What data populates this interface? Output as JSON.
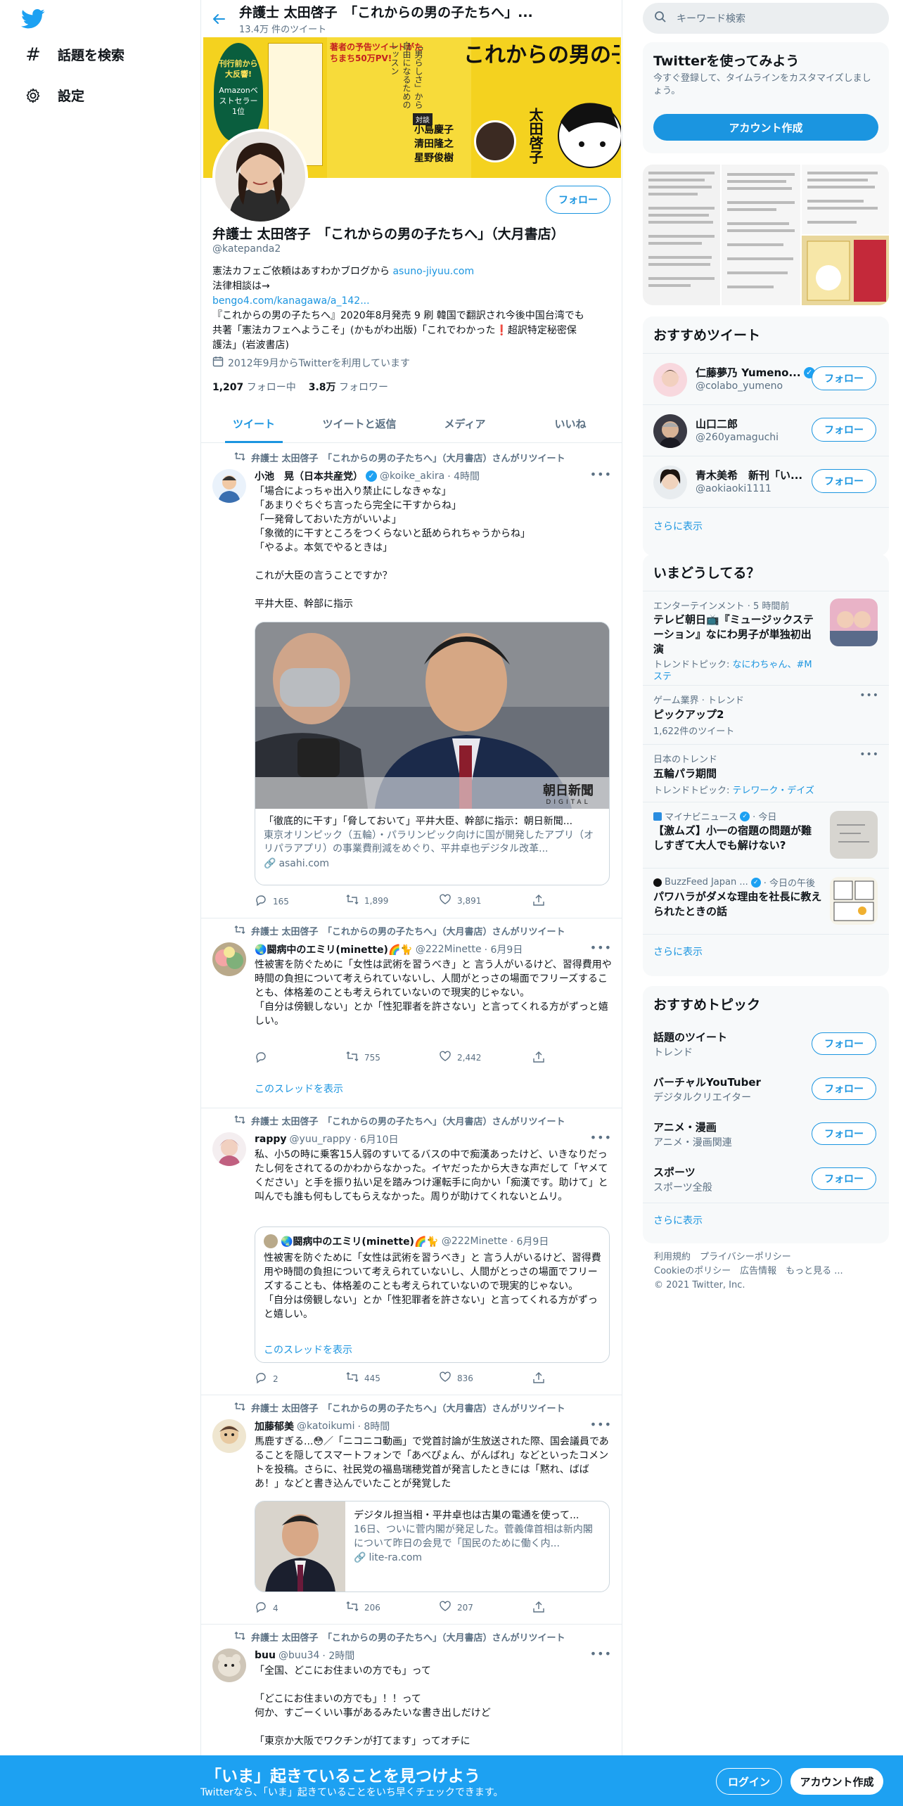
{
  "nav": {
    "explore": "話題を検索",
    "settings": "設定"
  },
  "header": {
    "title": "弁護士 太田啓子　「これからの男の子たちへ」...",
    "subtitle": "13.4万 件のツイート"
  },
  "banner": {
    "headline": "これからの男の子たちへ",
    "badge": "刊行前から大反響!",
    "badge2": "Amazonベストセラー1位",
    "promo": "著者の予告ツイートがたちまち50万PV!",
    "guests_label": "対談",
    "guests": [
      "小島慶子",
      "清田隆之",
      "星野俊樹"
    ],
    "author": "太田啓子"
  },
  "profile": {
    "name": "弁護士 太田啓子　「これからの男の子たちへ」（大月書店）",
    "handle": "@katepanda2",
    "follow_label": "フォロー",
    "bio_line1_pre": "憲法カフェご依頼はあすわかブログから ",
    "bio_line1_link": "asuno-jiyuu.com",
    "bio_line2": "法律相談は→",
    "bio_line3_link": "bengo4.com/kanagawa/a_142...",
    "bio_line4": "『これからの男の子たちへ』2020年8月発売  9 刷 韓国で翻訳され今後中国台湾でも",
    "bio_line5": "共著「憲法カフェへようこそ」(かもがわ出版)「これでわかった❗超訳特定秘密保",
    "bio_line6": "護法」(岩波書店)",
    "joined": "2012年9月からTwitterを利用しています",
    "following_count": "1,207",
    "following_label": "フォロー中",
    "followers_count": "3.8万",
    "followers_label": "フォロワー"
  },
  "tabs": [
    "ツイート",
    "ツイートと返信",
    "メディア",
    "いいね"
  ],
  "retweet_label": "弁護士 太田啓子　「これからの男の子たちへ」（大月書店）さんがリツイート",
  "tweets": [
    {
      "name": "小池　晃（日本共産党）",
      "handle": "@koike_akira",
      "time": "· 4時間",
      "text": "「場合によっちゃ出入り禁止にしなきゃな」\n「あまりぐちぐち言ったら完全に干すからね」\n「一発脅しておいた方がいいよ」\n「象徴的に干すところをつくらないと舐められちゃうからね」\n「やるよ。本気でやるときは」\n\nこれが大臣の言うことですか？\n\n平井大臣、幹部に指示",
      "card_title": "「徹底的に干す」「脅しておいて」平井大臣、幹部に指示：朝日新聞...",
      "card_desc": "東京オリンピック（五輪）・パラリンピック向けに国が開発したアプリ（オリパラアプリ）の事業費削減をめぐり、平井卓也デジタル改革...",
      "card_domain": "asahi.com",
      "card_logo": "朝日新聞",
      "card_logo_sub": "DIGITAL",
      "replies": "165",
      "retweets": "1,899",
      "likes": "3,891"
    },
    {
      "name": "🌏闘病中のエミリ(minette)🌈🐈",
      "handle": "@222Minette",
      "time": "· 6月9日",
      "text": "性被害を防ぐために「女性は武術を習うべき」と 言う人がいるけど、習得費用や時間の負担について考えられていないし、人間がとっさの場面でフリーズすることも、体格差のことも考えられていないので現実的じゃない。\n「自分は傍観しない」とか「性犯罪者を許さない」と言ってくれる方がずっと嬉しい。",
      "replies": "",
      "retweets": "755",
      "likes": "2,442",
      "show_thread": "このスレッドを表示"
    },
    {
      "name": "rappy",
      "handle": "@yuu_rappy",
      "time": "· 6月10日",
      "text": "私、小5の時に乗客15人弱のすいてるバスの中で痴漢あったけど、いきなりだったし何をされてるのかわからなかった。イヤだったから大きな声だして「ヤメてください」と手を振り払い足を踏みつけ運転手に向かい「痴漢です。助けて」と叫んでも誰も何もしてもらえなかった。周りが助けてくれないとムリ。",
      "quote_name": "🌏闘病中のエミリ(minette)🌈🐈",
      "quote_handle": "@222Minette",
      "quote_time": "· 6月9日",
      "quote_text": "性被害を防ぐために「女性は武術を習うべき」と 言う人がいるけど、習得費用や時間の負担について考えられていないし、人間がとっさの場面でフリーズすることも、体格差のことも考えられていないので現実的じゃない。\n「自分は傍観しない」とか「性犯罪者を許さない」と言ってくれる方がずっと嬉しい。",
      "quote_show_thread": "このスレッドを表示",
      "replies": "2",
      "retweets": "445",
      "likes": "836"
    },
    {
      "name": "加藤郁美",
      "handle": "@katoikumi",
      "time": "· 8時間",
      "text": "馬鹿すぎる...😳／「ニコニコ動画」で党首討論が生放送された際、国会議員であることを隠してスマートフォンで「あべぴょん、がんばれ」などといったコメントを投稿。さらに、社民党の福島瑞穂党首が発言したときには「黙れ、ばばあ！」などと書き込んでいたことが発覚した",
      "card_title": "デジタル担当相・平井卓也は古巣の電通を使って...",
      "card_desc": "16日、ついに菅内閣が発足した。菅義偉首相は新内閣について昨日の会見で「国民のために働く内...",
      "card_domain": "lite-ra.com",
      "replies": "4",
      "retweets": "206",
      "likes": "207"
    },
    {
      "name": "buu",
      "handle": "@buu34",
      "time": "· 2時間",
      "text": "「全国、どこにお住まいの方でも」って\n\n「どこにお住まいの方でも」！！って\n何か、すごーくいい事があるみたいな書き出しだけど\n\n「東京か大阪でワクチンが打てます」ってオチに"
    }
  ],
  "right": {
    "search_placeholder": "キーワード検索",
    "join_title": "Twitterを使ってみよう",
    "join_desc": "今すぐ登録して、タイムラインをカスタマイズしましょう。",
    "join_button": "アカウント作成",
    "rec_title": "おすすめツイート",
    "rec_users": [
      {
        "name": "仁藤夢乃 Yumeno...",
        "handle": "@colabo_yumeno",
        "verified": true
      },
      {
        "name": "山口二郎",
        "handle": "@260yamaguchi",
        "verified": false
      },
      {
        "name": "青木美希　新刊「い...",
        "handle": "@aokiaoki1111",
        "verified": false
      }
    ],
    "follow_label": "フォロー",
    "show_more": "さらに表示",
    "trends_title": "いまどうしてる？",
    "trends": [
      {
        "meta": "エンターテインメント · 5 時間前",
        "title": "テレビ朝日📺『ミュージックステーション』なにわ男子が単独初出演",
        "sub_pre": "トレンドトピック: ",
        "sub_links": "なにわちゃん、#Mステ"
      },
      {
        "meta": "ゲーム業界 · トレンド",
        "title": "ピックアップ2",
        "sub_pre": "1,622件のツイート",
        "sub_links": ""
      },
      {
        "meta": "日本のトレンド",
        "title": "五輪パラ期間",
        "sub_pre": "トレンドトピック: ",
        "sub_links": "テレワーク・デイズ"
      },
      {
        "meta_source": "マイナビニュース",
        "meta_time": "· 今日",
        "title": "【激ムズ】小一の宿題の問題が難しすぎて大人でも解けない?"
      },
      {
        "meta_source": "BuzzFeed Japan ...",
        "meta_time": "· 今日の午後",
        "title": "パワハラがダメな理由を社長に教えられたときの話"
      }
    ],
    "topics_title": "おすすめトピック",
    "topics": [
      {
        "name": "話題のツイート",
        "cat": "トレンド"
      },
      {
        "name": "バーチャルYouTuber",
        "cat": "デジタルクリエイター"
      },
      {
        "name": "アニメ・漫画",
        "cat": "アニメ・漫画関連"
      },
      {
        "name": "スポーツ",
        "cat": "スポーツ全般"
      }
    ],
    "footer_line1": "利用規約　プライバシーポリシー",
    "footer_line2": "Cookieのポリシー　広告情報　もっと見る ...",
    "footer_line3": "© 2021 Twitter, Inc."
  },
  "bottom": {
    "title": "「いま」起きていることを見つけよう",
    "subtitle": "Twitterなら、「いま」起きていることをいち早くチェックできます。",
    "login": "ログイン",
    "signup": "アカウント作成"
  },
  "colors": {
    "accent": "#1da1f2",
    "link": "#1b95e0",
    "banner": "#f4d21f"
  }
}
